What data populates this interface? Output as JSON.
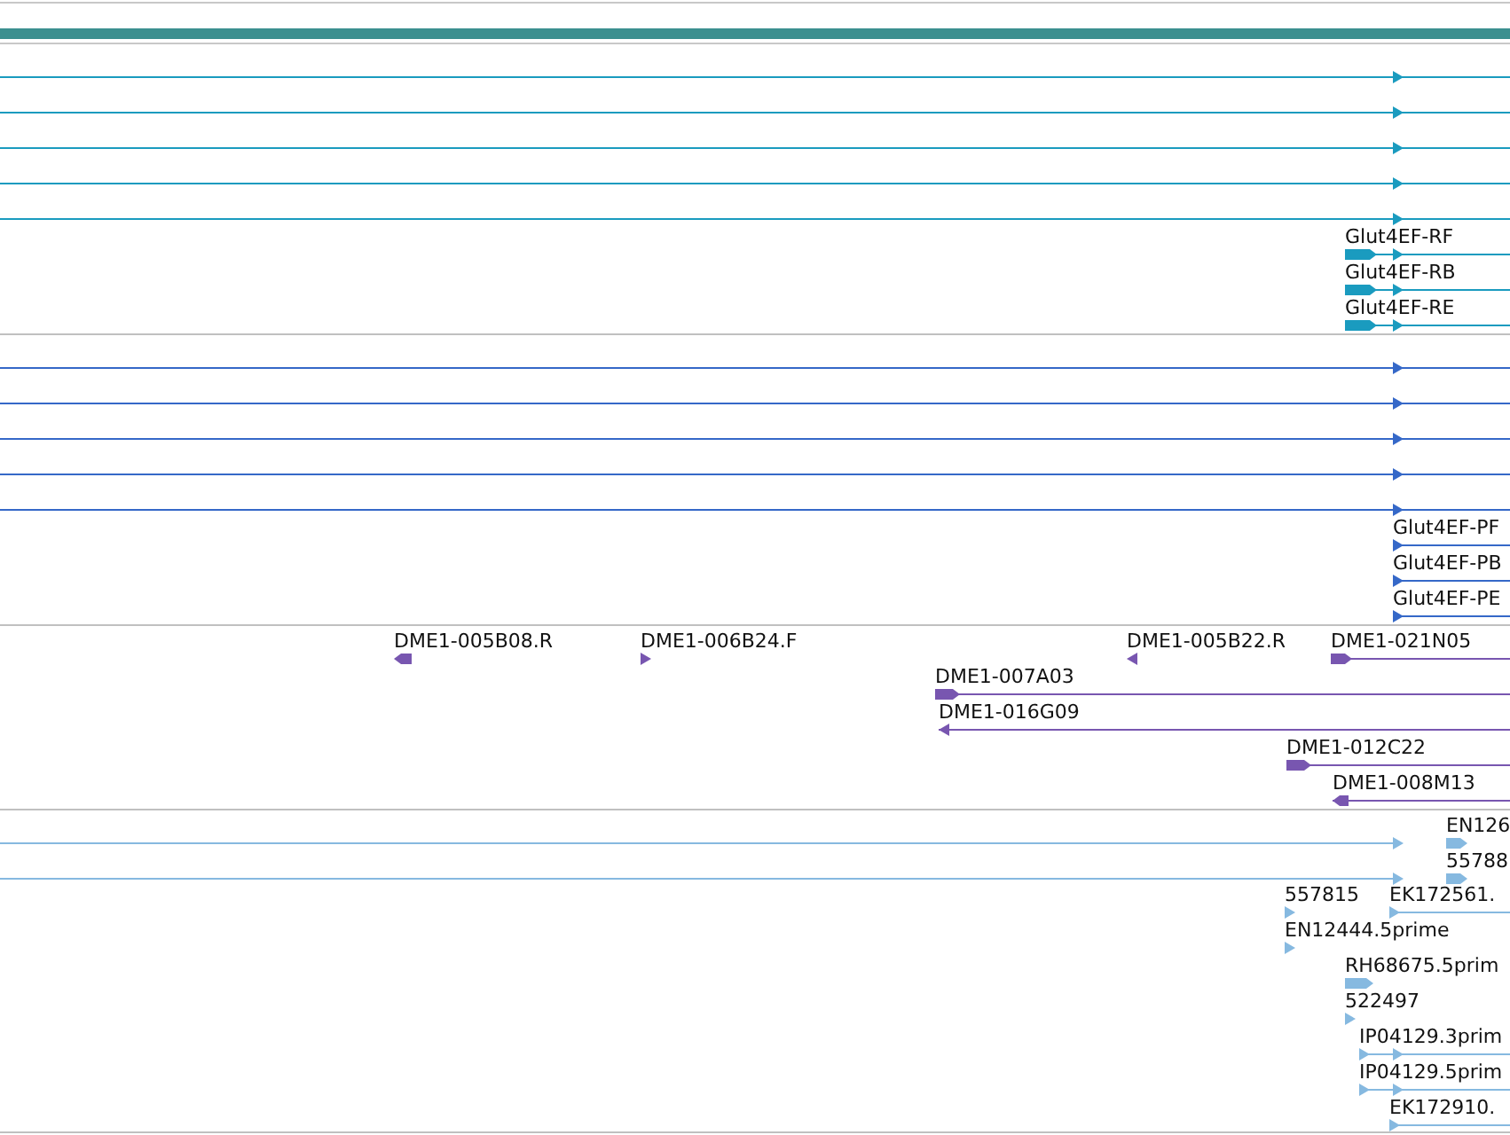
{
  "tracks": [
    {
      "kind": "gene",
      "color": "#3b8f8f"
    },
    {
      "kind": "features",
      "color": "#1a9bbf",
      "features": [
        {
          "reverse": false
        },
        {
          "reverse": false
        },
        {
          "reverse": false
        },
        {
          "reverse": false
        },
        {
          "reverse": false
        },
        {
          "label": "Glut4EF-RF",
          "reverse": false
        },
        {
          "label": "Glut4EF-RB",
          "reverse": false
        },
        {
          "label": "Glut4EF-RE",
          "reverse": false
        }
      ]
    },
    {
      "kind": "features",
      "color": "#3568c8",
      "features": [
        {
          "reverse": false
        },
        {
          "reverse": false
        },
        {
          "reverse": false
        },
        {
          "reverse": false
        },
        {
          "reverse": false
        },
        {
          "label": "Glut4EF-PF",
          "reverse": false
        },
        {
          "label": "Glut4EF-PB",
          "reverse": false
        },
        {
          "label": "Glut4EF-PE",
          "reverse": false
        }
      ]
    },
    {
      "kind": "features",
      "color": "#7856b0",
      "features": [
        {
          "label": "DME1-005B08.R",
          "reverse": true
        },
        {
          "label": "DME1-006B24.F",
          "reverse": false
        },
        {
          "label": "DME1-005B22.R",
          "reverse": true
        },
        {
          "label": "DME1-021N05",
          "reverse": false
        },
        {
          "label": "DME1-007A03",
          "reverse": false
        },
        {
          "label": "DME1-016G09",
          "reverse": true
        },
        {
          "label": "DME1-012C22",
          "reverse": false
        },
        {
          "label": "DME1-008M13",
          "reverse": true
        }
      ]
    },
    {
      "kind": "features",
      "color": "#86b9e0",
      "features": [
        {
          "reverse": false
        },
        {
          "reverse": false
        },
        {
          "label": "EN126",
          "reverse": false
        },
        {
          "label": "55788",
          "reverse": false
        },
        {
          "label": "557815",
          "reverse": false
        },
        {
          "label": "EK172561.",
          "reverse": false
        },
        {
          "label": "EN12444.5prime",
          "reverse": false
        },
        {
          "label": "RH68675.5prim",
          "reverse": false
        },
        {
          "label": "522497",
          "reverse": false
        },
        {
          "label": "IP04129.3prim",
          "reverse": false
        },
        {
          "label": "IP04129.5prim",
          "reverse": false
        },
        {
          "label": "EK172910.",
          "reverse": false
        }
      ]
    }
  ]
}
